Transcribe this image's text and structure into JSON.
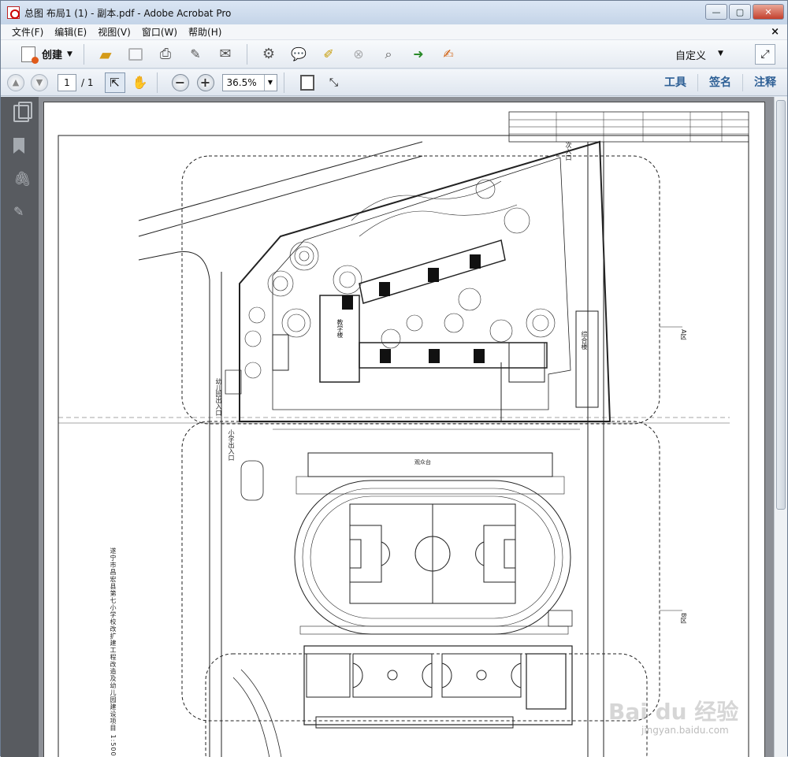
{
  "window": {
    "title": "总图 布局1 (1) - 副本.pdf - Adobe Acrobat Pro",
    "minimize": "—",
    "restore": "▢",
    "close": "✕"
  },
  "menu": {
    "items": [
      "文件(F)",
      "编辑(E)",
      "视图(V)",
      "窗口(W)",
      "帮助(H)"
    ],
    "close": "×"
  },
  "toolbar1": {
    "create_label": "创建",
    "custom_label": "自定义",
    "icons": [
      "open-folder-icon",
      "save-icon",
      "print-icon",
      "edit-icon",
      "email-icon",
      "settings-icon",
      "comment-icon",
      "highlight-icon",
      "delete-icon",
      "search-icon",
      "export-icon",
      "sign-icon"
    ]
  },
  "toolbar2": {
    "page_current": "1",
    "page_total": "/ 1",
    "zoom": "36.5%",
    "tabs": [
      "工具",
      "签名",
      "注释"
    ]
  },
  "drawing": {
    "title": "遂宁市昌宏县第七小学校改扩建工程改造及幼儿园建设项目 1:500",
    "labels": {
      "kindergarten_entrance": "幼儿园出入口",
      "school_entrance": "小学出入口",
      "side_entrance": "次入口",
      "stand": "观众台",
      "area_a": "A区",
      "area_b": "B区",
      "building1": "教学楼",
      "building2": "综合楼"
    },
    "watermark": "Bai du 经验",
    "watermark_url": "jingyan.baidu.com"
  }
}
